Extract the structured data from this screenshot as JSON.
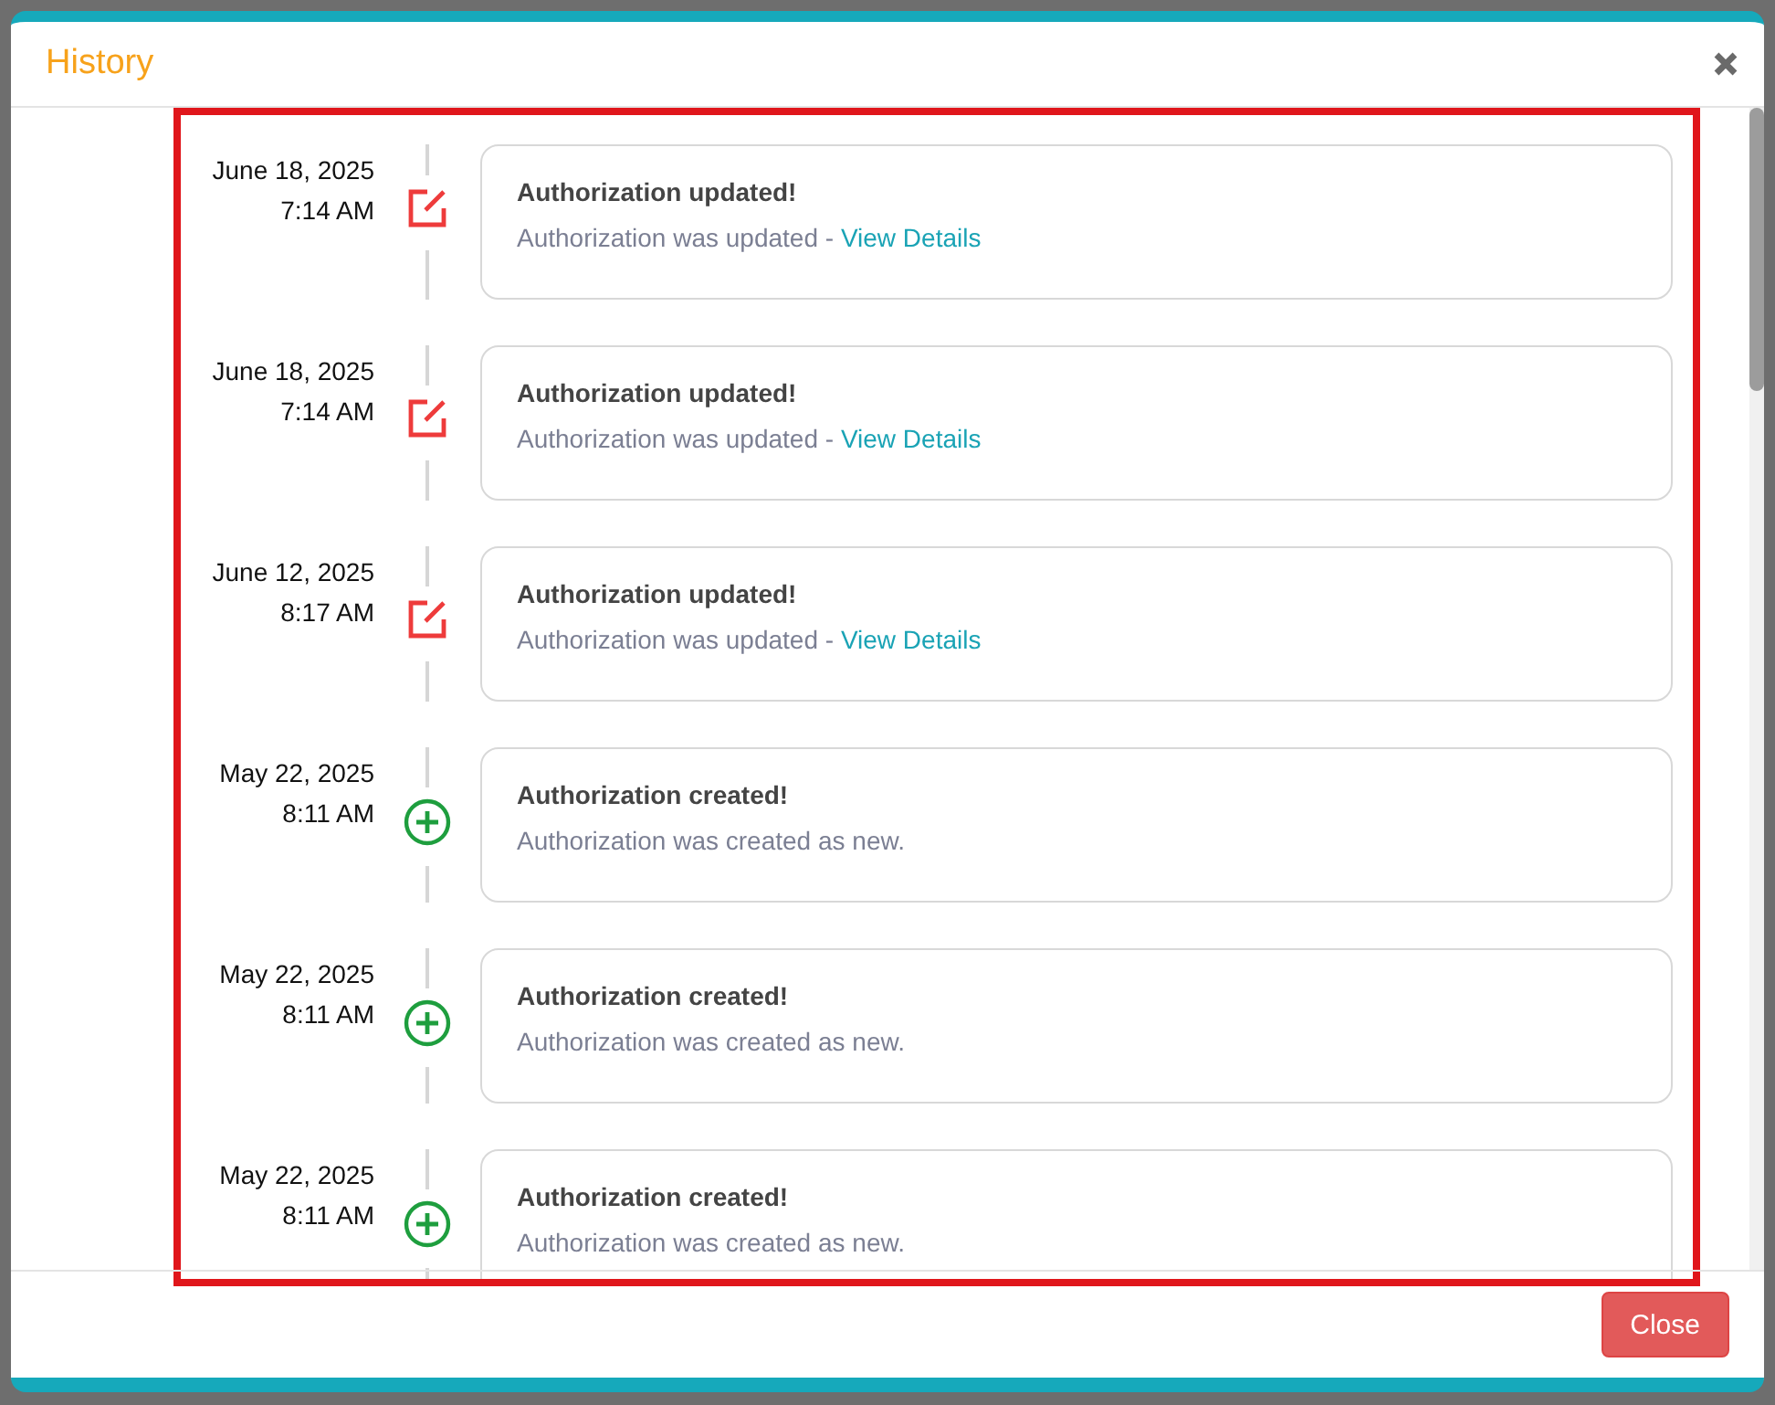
{
  "dialog": {
    "title": "History",
    "close_button": "Close"
  },
  "entries": [
    {
      "kind": "updated",
      "date": "June 18, 2025",
      "time": "7:14 AM",
      "title": "Authorization updated!",
      "text": "Authorization was updated - ",
      "link": "View Details"
    },
    {
      "kind": "updated",
      "date": "June 18, 2025",
      "time": "7:14 AM",
      "title": "Authorization updated!",
      "text": "Authorization was updated - ",
      "link": "View Details"
    },
    {
      "kind": "updated",
      "date": "June 12, 2025",
      "time": "8:17 AM",
      "title": "Authorization updated!",
      "text": "Authorization was updated - ",
      "link": "View Details"
    },
    {
      "kind": "created",
      "date": "May 22, 2025",
      "time": "8:11 AM",
      "title": "Authorization created!",
      "text": "Authorization was created as new."
    },
    {
      "kind": "created",
      "date": "May 22, 2025",
      "time": "8:11 AM",
      "title": "Authorization created!",
      "text": "Authorization was created as new."
    },
    {
      "kind": "created",
      "date": "May 22, 2025",
      "time": "8:11 AM",
      "title": "Authorization created!",
      "text": "Authorization was created as new."
    }
  ]
}
